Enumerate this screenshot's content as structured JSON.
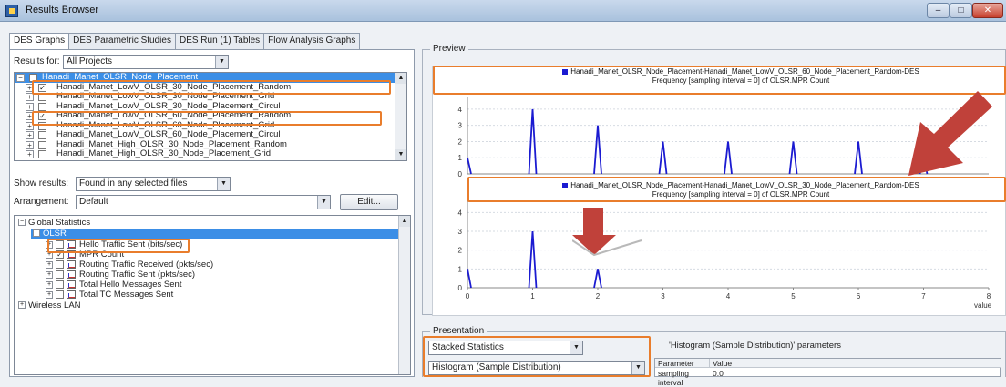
{
  "window": {
    "title": "Results Browser",
    "minimize": "–",
    "maximize": "□",
    "close": "✕"
  },
  "tabs": [
    {
      "label": "DES Graphs",
      "active": true
    },
    {
      "label": "DES Parametric Studies",
      "active": false
    },
    {
      "label": "DES Run (1) Tables",
      "active": false
    },
    {
      "label": "Flow Analysis Graphs",
      "active": false
    }
  ],
  "results_for": {
    "label": "Results for:",
    "value": "All Projects"
  },
  "scenarios": [
    {
      "name": "Hanadi_Manet_OLSR_Node_Placement",
      "checked": false,
      "selected": true,
      "root": true
    },
    {
      "name": "Hanadi_Manet_LowV_OLSR_30_Node_Placement_Random",
      "checked": true,
      "selected": false,
      "root": false
    },
    {
      "name": "Hanadi_Manet_LowV_OLSR_30_Node_Placement_Grid",
      "checked": false,
      "selected": false,
      "root": false
    },
    {
      "name": "Hanadi_Manet_LowV_OLSR_30_Node_Placement_Circul",
      "checked": false,
      "selected": false,
      "root": false
    },
    {
      "name": "Hanadi_Manet_LowV_OLSR_60_Node_Placement_Random",
      "checked": true,
      "selected": false,
      "root": false
    },
    {
      "name": "Hanadi_Manet_LowV_OLSR_60_Node_Placement_Grid",
      "checked": false,
      "selected": false,
      "root": false
    },
    {
      "name": "Hanadi_Manet_LowV_OLSR_60_Node_Placement_Circul",
      "checked": false,
      "selected": false,
      "root": false
    },
    {
      "name": "Hanadi_Manet_High_OLSR_30_Node_Placement_Random",
      "checked": false,
      "selected": false,
      "root": false
    },
    {
      "name": "Hanadi_Manet_High_OLSR_30_Node_Placement_Grid",
      "checked": false,
      "selected": false,
      "root": false
    }
  ],
  "show_results": {
    "label": "Show results:",
    "value": "Found in any selected files"
  },
  "arrangement": {
    "label": "Arrangement:",
    "value": "Default",
    "edit": "Edit..."
  },
  "stats_tree": {
    "global": "Global Statistics",
    "olsr": "OLSR",
    "items": [
      "Hello Traffic Sent (bits/sec)",
      "MPR Count",
      "Routing Traffic Received (pkts/sec)",
      "Routing Traffic Sent (pkts/sec)",
      "Total Hello Messages Sent",
      "Total TC Messages Sent"
    ],
    "wireless": "Wireless LAN"
  },
  "preview": {
    "group_label": "Preview",
    "x_unit": "value"
  },
  "chart_data": [
    {
      "type": "line",
      "legend": "Hanadi_Manet_OLSR_Node_Placement-Hanadi_Manet_LowV_OLSR_60_Node_Placement_Random-DES",
      "title": "Frequency [sampling interval = 0] of OLSR.MPR Count",
      "x": [
        0,
        1,
        2,
        3,
        4,
        5,
        6,
        7
      ],
      "series": [
        {
          "name": "Hanadi_Manet_OLSR_Node_Placement-Hanadi_Manet_LowV_OLSR_60_Node_Placement_Random-DES",
          "values": [
            1,
            4,
            3,
            2,
            2,
            2,
            2,
            1
          ]
        }
      ],
      "yticks": [
        "0",
        "1",
        "2",
        "3",
        "4"
      ],
      "ylim": [
        0,
        4.5
      ],
      "xlim": [
        0,
        8
      ],
      "color": "#1b1bd1"
    },
    {
      "type": "line",
      "legend": "Hanadi_Manet_OLSR_Node_Placement-Hanadi_Manet_LowV_OLSR_30_Node_Placement_Random-DES",
      "title": "Frequency [sampling interval = 0] of OLSR.MPR Count",
      "x": [
        0,
        1,
        2
      ],
      "series": [
        {
          "name": "Hanadi_Manet_OLSR_Node_Placement-Hanadi_Manet_LowV_OLSR_30_Node_Placement_Random-DES",
          "values": [
            1,
            3,
            1
          ]
        }
      ],
      "xticks": [
        "0",
        "1",
        "2",
        "3",
        "4",
        "5",
        "6",
        "7",
        "8"
      ],
      "xlabel": "value",
      "yticks": [
        "0",
        "1",
        "2",
        "3",
        "4"
      ],
      "ylim": [
        0,
        4.5
      ],
      "xlim": [
        0,
        8
      ],
      "color": "#1b1bd1"
    }
  ],
  "presentation": {
    "group_label": "Presentation",
    "stacking": "Stacked Statistics",
    "chart_type": "Histogram (Sample Distribution)",
    "params_label": "'Histogram (Sample Distribution)' parameters",
    "param_header": "Parameter",
    "value_header": "Value",
    "param_name": "sampling interval",
    "param_value": "0.0"
  },
  "colors": {
    "highlight": "#e97d2c",
    "series": "#1b1bd1",
    "arrow": "#c0413a",
    "selection": "#3b8ee6"
  }
}
